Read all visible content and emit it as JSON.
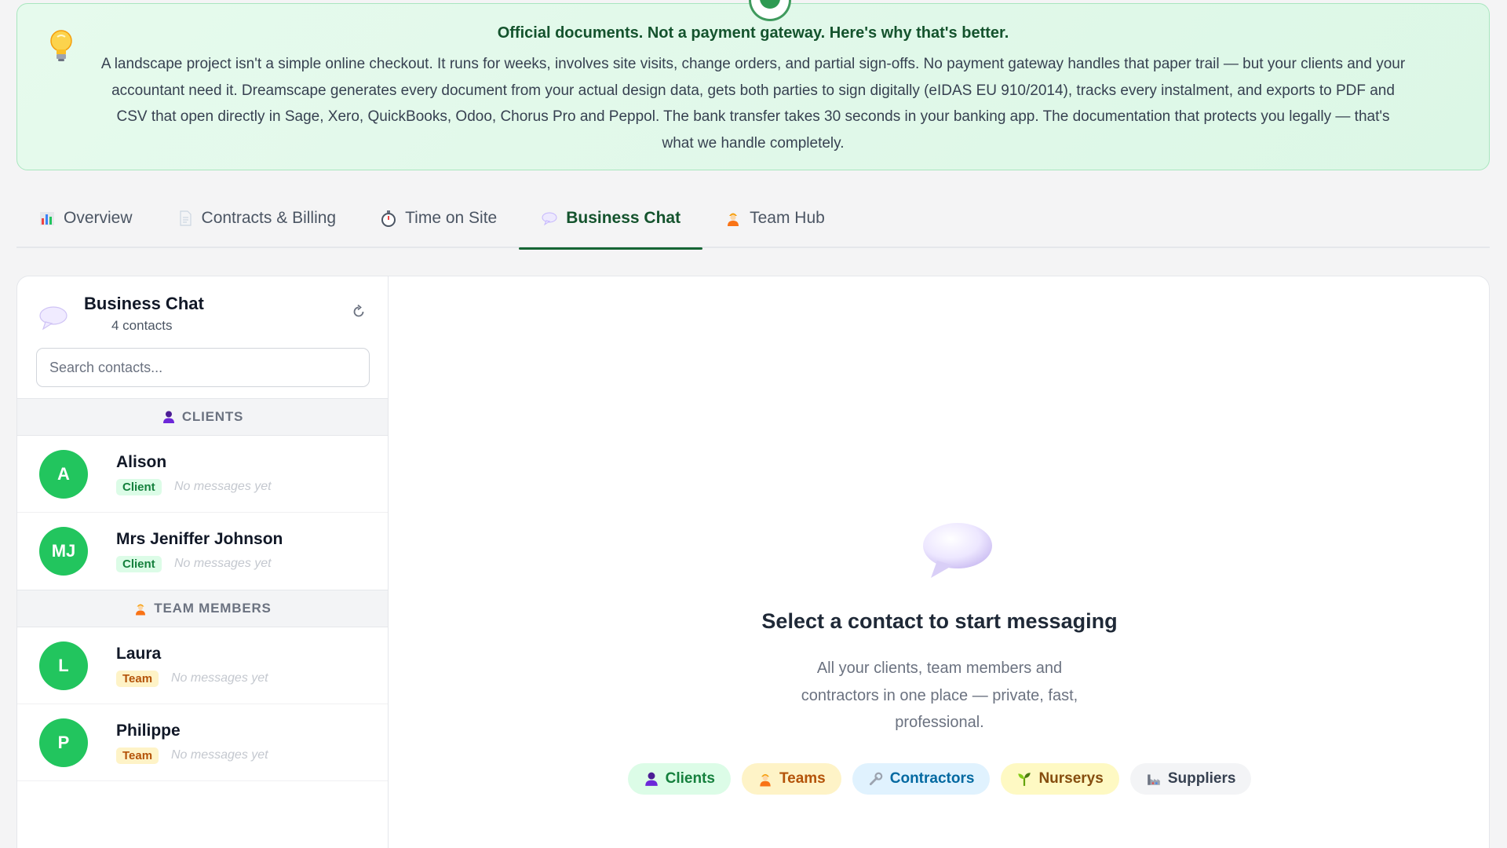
{
  "banner": {
    "title": "Official documents. Not a payment gateway. Here's why that's better.",
    "body": "A landscape project isn't a simple online checkout. It runs for weeks, involves site visits, change orders, and partial sign-offs. No payment gateway handles that paper trail — but your clients and your accountant need it. Dreamscape generates every document from your actual design data, gets both parties to sign digitally (eIDAS EU 910/2014), tracks every instalment, and exports to PDF and CSV that open directly in Sage, Xero, QuickBooks, Odoo, Chorus Pro and Peppol. The bank transfer takes 30 seconds in your banking app. The documentation that protects you legally — that's what we handle completely.",
    "icon": "lightbulb-icon"
  },
  "tabs": [
    {
      "label": "Overview",
      "icon": "bar-chart-icon",
      "active": false
    },
    {
      "label": "Contracts & Billing",
      "icon": "document-icon",
      "active": false
    },
    {
      "label": "Time on Site",
      "icon": "stopwatch-icon",
      "active": false
    },
    {
      "label": "Business Chat",
      "icon": "speech-bubble-icon",
      "active": true
    },
    {
      "label": "Team Hub",
      "icon": "worker-icon",
      "active": false
    }
  ],
  "sidebar": {
    "title": "Business Chat",
    "count": "4 contacts",
    "search_placeholder": "Search contacts...",
    "groups": [
      {
        "label": "CLIENTS",
        "icon": "person-icon",
        "contacts": [
          {
            "initials": "A",
            "name": "Alison",
            "role": "Client",
            "preview": "No messages yet"
          },
          {
            "initials": "MJ",
            "name": "Mrs Jeniffer Johnson",
            "role": "Client",
            "preview": "No messages yet"
          }
        ]
      },
      {
        "label": "TEAM MEMBERS",
        "icon": "worker-icon",
        "contacts": [
          {
            "initials": "L",
            "name": "Laura",
            "role": "Team",
            "preview": "No messages yet"
          },
          {
            "initials": "P",
            "name": "Philippe",
            "role": "Team",
            "preview": "No messages yet"
          }
        ]
      }
    ]
  },
  "empty_state": {
    "title": "Select a contact to start messaging",
    "body": "All your clients, team members and contractors in one place — private, fast, professional.",
    "chips": [
      {
        "label": "Clients",
        "icon": "person-icon",
        "bg": "#dcfce7",
        "color": "#15803d"
      },
      {
        "label": "Teams",
        "icon": "worker-icon",
        "bg": "#fef3c7",
        "color": "#b45309"
      },
      {
        "label": "Contractors",
        "icon": "wrench-icon",
        "bg": "#e0f2fe",
        "color": "#0369a1"
      },
      {
        "label": "Nurserys",
        "icon": "seedling-icon",
        "bg": "#fef9c3",
        "color": "#854d0e"
      },
      {
        "label": "Suppliers",
        "icon": "factory-icon",
        "bg": "#f3f4f6",
        "color": "#374151"
      }
    ]
  },
  "colors": {
    "accent": "#166534",
    "avatar": "#22c55e",
    "banner_bg": "#e6faed"
  }
}
